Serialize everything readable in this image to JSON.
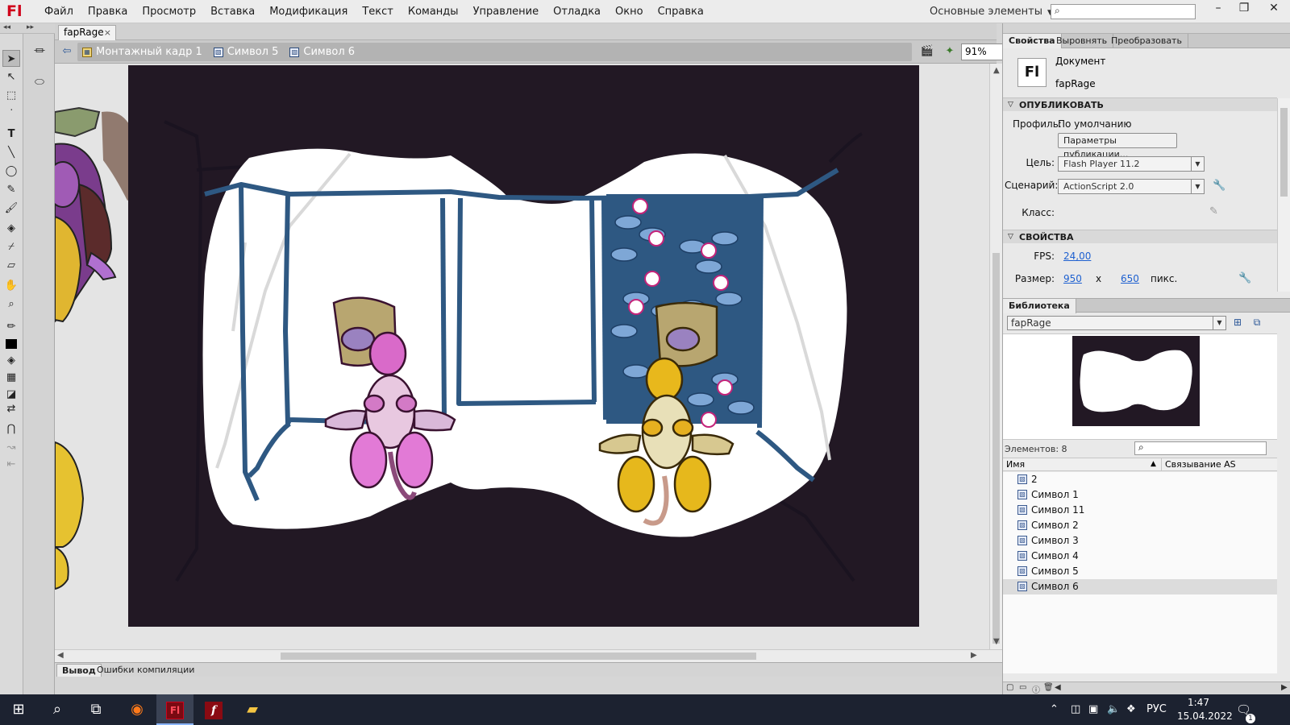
{
  "app": {
    "logo": "Fl"
  },
  "menu": [
    "Файл",
    "Правка",
    "Просмотр",
    "Вставка",
    "Модификация",
    "Текст",
    "Команды",
    "Управление",
    "Отладка",
    "Окно",
    "Справка"
  ],
  "workspace": {
    "label": "Основные элементы"
  },
  "window_controls": {
    "minimize": "–",
    "restore": "❐",
    "close": "✕"
  },
  "document_tab": {
    "title": "fapRage",
    "close": "×"
  },
  "breadcrumbs": [
    "Монтажный кадр 1",
    "Символ 5",
    "Символ 6"
  ],
  "zoom": {
    "value": "91%"
  },
  "output_tabs": [
    "Вывод",
    "Ошибки компиляции"
  ],
  "properties_panel": {
    "tabs": [
      "Свойства",
      "Выровнять",
      "Преобразовать"
    ],
    "doc_icon": "Fl",
    "doc_type": "Документ",
    "doc_name": "fapRage",
    "publish": {
      "header": "ОПУБЛИКОВАТЬ",
      "profile_label": "Профиль:",
      "profile_value": "По умолчанию",
      "settings_button": "Параметры публикации...",
      "target_label": "Цель:",
      "target_value": "Flash Player 11.2",
      "script_label": "Сценарий:",
      "script_value": "ActionScript 2.0",
      "class_label": "Класс:"
    },
    "properties": {
      "header": "СВОЙСТВА",
      "fps_label": "FPS:",
      "fps_value": "24,00",
      "size_label": "Размер:",
      "width": "950",
      "x": "x",
      "height": "650",
      "unit": "пикс."
    }
  },
  "library": {
    "tab": "Библиотека",
    "selected_doc": "fapRage",
    "count": "Элементов: 8",
    "col_name": "Имя",
    "col_linkage": "Связывание AS",
    "items": [
      "2",
      "Символ 1",
      "Символ 11",
      "Символ 2",
      "Символ 3",
      "Символ 4",
      "Символ 5",
      "Символ 6"
    ],
    "selected_item": "Символ 6"
  },
  "taskbar": {
    "tray_lang": "РУС",
    "time": "1:47",
    "date": "15.04.2022",
    "notifications": "1"
  },
  "colors": {
    "stage_bg": "#221824",
    "stroke": "#2e5882",
    "accent_red": "#d0021b",
    "link_blue": "#1e60d0"
  }
}
